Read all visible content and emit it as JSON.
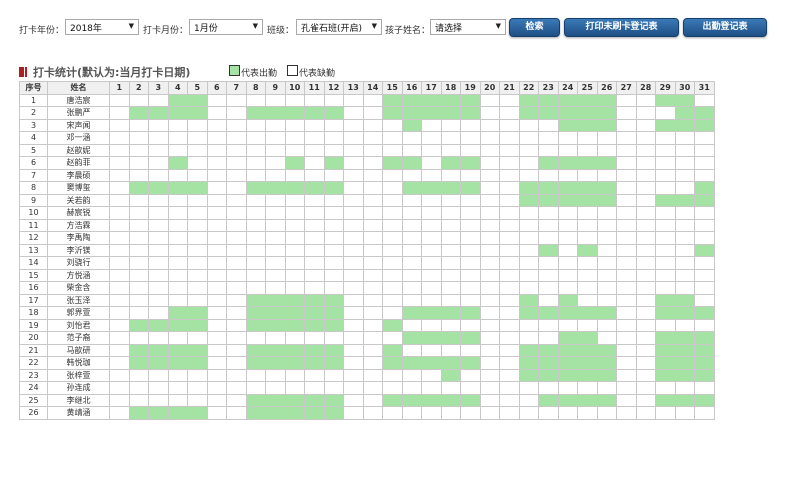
{
  "filters": {
    "year_label": "打卡年份：",
    "year_value": "2018年",
    "month_label": "打卡月份：",
    "month_value": "1月份",
    "class_label": "班级：",
    "class_value": "孔雀石班(开启)",
    "child_label": "孩子姓名：",
    "child_value": "请选择"
  },
  "buttons": {
    "search": "检索",
    "print_unswiped": "打印未刷卡登记表",
    "attendance_register": "出勤登记表"
  },
  "section": {
    "title": "打卡统计(默认为:当月打卡日期)",
    "legend_present": "代表出勤",
    "legend_absent": "代表缺勤"
  },
  "colors": {
    "present": "#a4e3a4",
    "absent": "#ffffff",
    "button": "#2a6299",
    "title_mark": "#b02020"
  },
  "table": {
    "col_index": "序号",
    "col_name": "姓名",
    "days": [
      "1",
      "2",
      "3",
      "4",
      "5",
      "6",
      "7",
      "8",
      "9",
      "10",
      "11",
      "12",
      "13",
      "14",
      "15",
      "16",
      "17",
      "18",
      "19",
      "20",
      "21",
      "22",
      "23",
      "24",
      "25",
      "26",
      "27",
      "28",
      "29",
      "30",
      "31"
    ],
    "rows": [
      {
        "index": "1",
        "name": "唐浩宸",
        "present": [
          4,
          5,
          15,
          16,
          17,
          18,
          19,
          22,
          23,
          24,
          25,
          26,
          29,
          30
        ]
      },
      {
        "index": "2",
        "name": "张鹏严",
        "present": [
          2,
          3,
          4,
          5,
          8,
          9,
          10,
          11,
          12,
          15,
          16,
          17,
          18,
          19,
          22,
          23,
          24,
          25,
          26,
          30,
          31
        ]
      },
      {
        "index": "3",
        "name": "宋声闻",
        "present": [
          16,
          24,
          25,
          26,
          29,
          30,
          31
        ]
      },
      {
        "index": "4",
        "name": "邓一涵",
        "present": []
      },
      {
        "index": "5",
        "name": "赵歆妮",
        "present": []
      },
      {
        "index": "6",
        "name": "赵韵菲",
        "present": [
          4,
          10,
          12,
          15,
          16,
          18,
          19,
          23,
          24,
          25,
          26
        ]
      },
      {
        "index": "7",
        "name": "李晨硕",
        "present": []
      },
      {
        "index": "8",
        "name": "窦博玺",
        "present": [
          2,
          3,
          4,
          5,
          8,
          9,
          10,
          11,
          12,
          16,
          17,
          18,
          19,
          22,
          23,
          24,
          25,
          26,
          31
        ]
      },
      {
        "index": "9",
        "name": "关若韵",
        "present": [
          22,
          23,
          24,
          25,
          26,
          29,
          30,
          31
        ]
      },
      {
        "index": "10",
        "name": "赫宸锐",
        "present": []
      },
      {
        "index": "11",
        "name": "方浩霖",
        "present": []
      },
      {
        "index": "12",
        "name": "李禹陶",
        "present": []
      },
      {
        "index": "13",
        "name": "李沂镁",
        "present": [
          23,
          25,
          31
        ]
      },
      {
        "index": "14",
        "name": "刘骁行",
        "present": []
      },
      {
        "index": "15",
        "name": "方悦涵",
        "present": []
      },
      {
        "index": "16",
        "name": "柴金含",
        "present": []
      },
      {
        "index": "17",
        "name": "张玉泽",
        "present": [
          8,
          9,
          10,
          11,
          12,
          22,
          24,
          29,
          30
        ]
      },
      {
        "index": "18",
        "name": "郭界萱",
        "present": [
          4,
          5,
          8,
          9,
          10,
          11,
          12,
          16,
          17,
          18,
          19,
          22,
          23,
          24,
          25,
          26,
          29,
          30,
          31
        ]
      },
      {
        "index": "19",
        "name": "刘怡君",
        "present": [
          2,
          3,
          4,
          5,
          8,
          9,
          10,
          11,
          12,
          15
        ]
      },
      {
        "index": "20",
        "name": "范子裔",
        "present": [
          16,
          17,
          18,
          19,
          24,
          25,
          29,
          30,
          31
        ]
      },
      {
        "index": "21",
        "name": "马歆研",
        "present": [
          2,
          3,
          4,
          5,
          8,
          9,
          10,
          11,
          12,
          15,
          22,
          23,
          24,
          25,
          26,
          29,
          30,
          31
        ]
      },
      {
        "index": "22",
        "name": "韩悦珈",
        "present": [
          2,
          3,
          4,
          5,
          8,
          9,
          10,
          11,
          12,
          15,
          16,
          17,
          18,
          19,
          22,
          23,
          24,
          25,
          26,
          29,
          30,
          31
        ]
      },
      {
        "index": "23",
        "name": "张梓萱",
        "present": [
          18,
          22,
          23,
          24,
          25,
          26,
          29,
          30,
          31
        ]
      },
      {
        "index": "24",
        "name": "孙连成",
        "present": []
      },
      {
        "index": "25",
        "name": "李继北",
        "present": [
          8,
          9,
          10,
          11,
          12,
          15,
          16,
          17,
          18,
          19,
          23,
          24,
          25,
          26,
          29,
          30,
          31
        ]
      },
      {
        "index": "26",
        "name": "黄靖涵",
        "present": [
          2,
          3,
          4,
          5,
          8,
          9,
          10,
          11,
          12
        ]
      }
    ]
  }
}
